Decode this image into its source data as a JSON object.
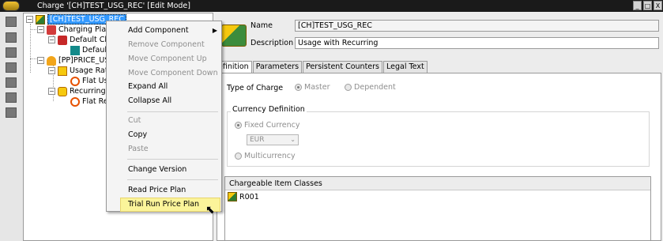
{
  "window": {
    "title": "Charge '[CH]TEST_USG_REC' [Edit Mode]",
    "controls": [
      "_",
      "□",
      "X"
    ]
  },
  "tree": {
    "nodes": [
      {
        "label": "[CH]TEST_USG_REC",
        "icon": "charge-icon"
      },
      {
        "label": "Charging Plan",
        "icon": "charging-plan-icon"
      },
      {
        "label": "Default Cha",
        "icon": "default-charge-icon"
      },
      {
        "label": "Default",
        "icon": "default-item-icon"
      },
      {
        "label": "[PP]PRICE_USG",
        "icon": "price-plan-icon"
      },
      {
        "label": "Usage Rate",
        "icon": "usage-rate-icon"
      },
      {
        "label": "Flat Usa",
        "icon": "flat-icon"
      },
      {
        "label": "Recurring R",
        "icon": "recurring-rate-icon"
      },
      {
        "label": "Flat Rec",
        "icon": "flat-icon"
      }
    ]
  },
  "context_menu": {
    "items": [
      {
        "label": "Add Component",
        "state": "enabled",
        "submenu": true
      },
      {
        "label": "Remove Component",
        "state": "disabled"
      },
      {
        "label": "Move Component Up",
        "state": "disabled"
      },
      {
        "label": "Move Component Down",
        "state": "disabled"
      },
      {
        "label": "Expand All",
        "state": "enabled"
      },
      {
        "label": "Collapse All",
        "state": "enabled"
      },
      {
        "label": "Cut",
        "state": "disabled"
      },
      {
        "label": "Copy",
        "state": "enabled"
      },
      {
        "label": "Paste",
        "state": "disabled"
      },
      {
        "label": "Change Version",
        "state": "enabled"
      },
      {
        "label": "Read Price Plan",
        "state": "enabled"
      },
      {
        "label": "Trial Run Price Plan",
        "state": "highlighted"
      }
    ],
    "submenu_arrow": "▶"
  },
  "details": {
    "name_label": "Name",
    "name_value": "[CH]TEST_USG_REC",
    "description_label": "Description",
    "description_value": "Usage with Recurring"
  },
  "tabs": {
    "items": [
      "efinition",
      "Parameters",
      "Persistent Counters",
      "Legal Text"
    ],
    "active": "efinition"
  },
  "definition": {
    "type_of_charge_label": "Type of Charge",
    "master_label": "Master",
    "dependent_label": "Dependent",
    "currency_group_title": "Currency Definition",
    "fixed_currency_label": "Fixed Currency",
    "currency_value": "EUR",
    "multicurrency_label": "Multicurrency"
  },
  "item_classes": {
    "header": "Chargeable Item Classes",
    "rows": [
      "R001"
    ]
  }
}
